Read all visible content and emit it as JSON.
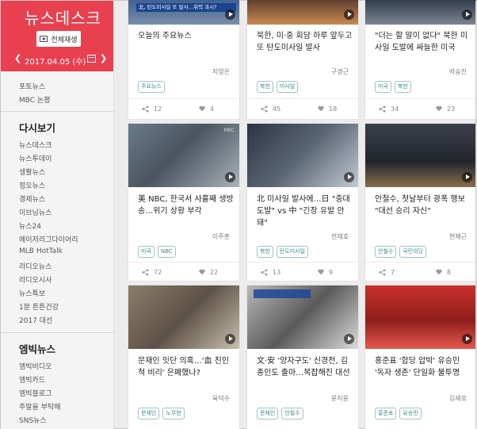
{
  "sidebar": {
    "title": "뉴스데스크",
    "replay_label": "전체재생",
    "date": "2017.04.05 (수)",
    "prev_icon": "chevron-left-icon",
    "next_icon": "chevron-right-icon",
    "top_links": [
      "포토뉴스",
      "MBC 논평"
    ],
    "section1": "다시보기",
    "section1_links": [
      "뉴스데스크",
      "뉴스투데이",
      "생활뉴스",
      "정오뉴스",
      "경제뉴스",
      "이브닝뉴스",
      "뉴스24",
      "메이저리그다이어리",
      "MLB HotTalk",
      "라디오뉴스",
      "라디오시사",
      "뉴스특보",
      "1분 튼튼건강",
      "2017 대선"
    ],
    "section2": "엠빅뉴스",
    "section2_links": [
      "엠빅비디오",
      "엠빅카드",
      "엠빅블로그",
      "주말을 부탁해",
      "SNS뉴스"
    ]
  },
  "cards": [
    {
      "title": "오늘의 주요뉴스",
      "author": "지영은",
      "tags": [
        "주요뉴스"
      ],
      "shares": "12",
      "likes": "4",
      "banner": "北, 탄도미사일 또 발사…위력 과시?"
    },
    {
      "title": "북한, 미·중 회담 하루 앞두고 또 탄도미사일 발사",
      "author": "구경근",
      "tags": [
        "북한",
        "미사일"
      ],
      "shares": "45",
      "likes": "18",
      "banner": ""
    },
    {
      "title": "\"더는 할 말이 없다\" 북한 미사일 도발에 싸늘한 미국",
      "author": "박승진",
      "tags": [
        "미국",
        "북한"
      ],
      "shares": "34",
      "likes": "23",
      "banner": ""
    },
    {
      "title": "美 NBC, 한국서 사흘째 생방송…위기 상황 부각",
      "author": "이주훈",
      "tags": [
        "미국",
        "NBC"
      ],
      "shares": "72",
      "likes": "22",
      "banner": ""
    },
    {
      "title": "北 미사일 발사에…日 \"중대 도발\" vs 中 \"긴장 유발 안 돼\"",
      "author": "전재호",
      "tags": [
        "북한",
        "탄도미사일"
      ],
      "shares": "13",
      "likes": "9",
      "banner": ""
    },
    {
      "title": "안철수, 첫날부터 광폭 행보 \"대선 승리 자신\"",
      "author": "현재근",
      "tags": [
        "안철수",
        "국민의당"
      ],
      "shares": "7",
      "likes": "8",
      "banner": ""
    },
    {
      "title": "문재인 잇단 의혹…'血 친인척 비리' 은폐했나?",
      "author": "육덕수",
      "tags": [
        "문재인",
        "노무현"
      ],
      "shares": "",
      "likes": "",
      "banner": ""
    },
    {
      "title": "文·安 '양자구도' 신경전, 김종인도 출마…복잡해진 대선",
      "author": "윤지윤",
      "tags": [
        "문재인",
        "안철수"
      ],
      "shares": "",
      "likes": "",
      "banner": ""
    },
    {
      "title": "홍준표 '합당 압박' 유승민 '독자 생존' 단일화 불투명",
      "author": "김세로",
      "tags": [
        "홍준표",
        "유승민"
      ],
      "shares": "",
      "likes": "",
      "banner": ""
    }
  ],
  "colors": {
    "brand_red": "#e8404f",
    "tag_teal": "#3a8a8f"
  },
  "icons": {
    "share": "share-icon",
    "like": "heart-icon",
    "play": "play-icon",
    "calendar": "calendar-icon"
  }
}
